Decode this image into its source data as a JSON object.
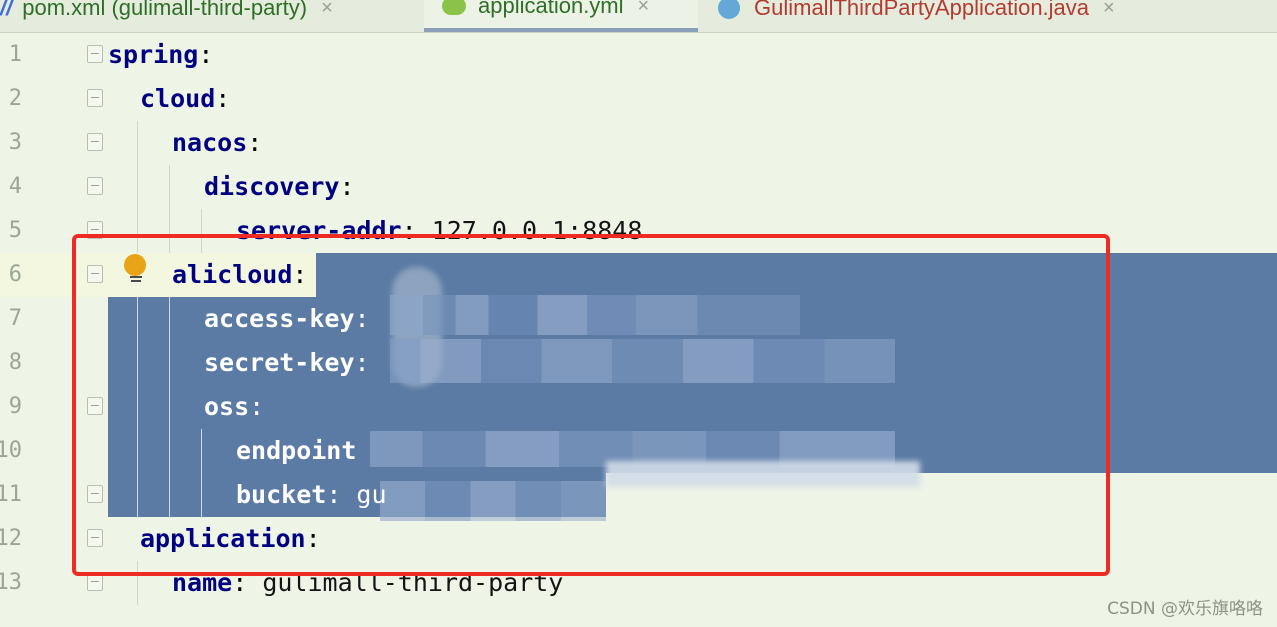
{
  "tabs": [
    {
      "label": "pom.xml (gulimall-third-party)",
      "icon": "maven-file-icon",
      "active": false
    },
    {
      "label": "application.yml",
      "icon": "yaml-spring-icon",
      "active": true
    },
    {
      "label": "GulimallThirdPartyApplication.java",
      "icon": "java-class-icon",
      "active": false
    }
  ],
  "tab_close_glyph": "×",
  "lines": [
    {
      "num": "1",
      "key": "spring",
      "sep": ":",
      "value": ""
    },
    {
      "num": "2",
      "key": "cloud",
      "sep": ":",
      "value": ""
    },
    {
      "num": "3",
      "key": "nacos",
      "sep": ":",
      "value": ""
    },
    {
      "num": "4",
      "key": "discovery",
      "sep": ":",
      "value": ""
    },
    {
      "num": "5",
      "key": "server-addr",
      "sep": ":",
      "value": " 127.0.0.1:8848"
    },
    {
      "num": "6",
      "key": "alicloud",
      "sep": ":",
      "value": ""
    },
    {
      "num": "7",
      "key": "access-key",
      "sep": ":",
      "value": ""
    },
    {
      "num": "8",
      "key": "secret-key",
      "sep": ":",
      "value": ""
    },
    {
      "num": "9",
      "key": "oss",
      "sep": ":",
      "value": ""
    },
    {
      "num": "10",
      "key": "endpoint",
      "sep": "",
      "value": ""
    },
    {
      "num": "11",
      "key": "bucket",
      "sep": ":",
      "value": " gu"
    },
    {
      "num": "12",
      "key": "application",
      "sep": ":",
      "value": ""
    },
    {
      "num": "13",
      "key": "name",
      "sep": ":",
      "value": " gulimall-third-party"
    }
  ],
  "watermark": "CSDN @欢乐旗咯咯",
  "colors": {
    "selection": "#5b7ba4",
    "key": "#000080",
    "annotation_box": "#ee2b23",
    "intention_bulb": "#e8a317"
  }
}
